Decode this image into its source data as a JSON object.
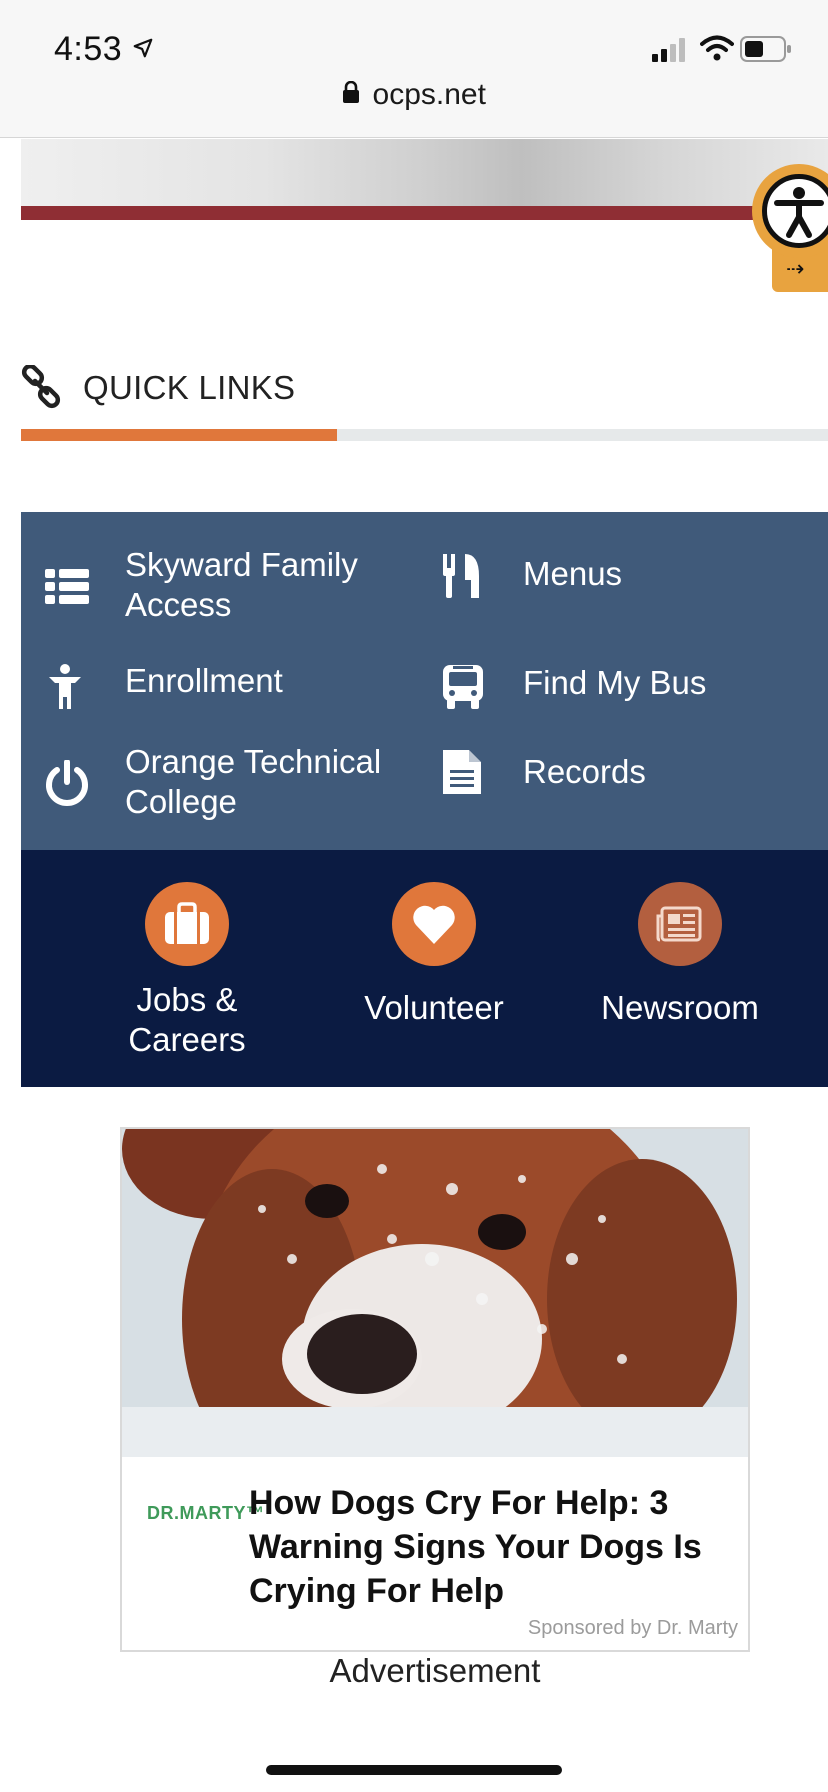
{
  "status_bar": {
    "time": "4:53"
  },
  "browser": {
    "url": "ocps.net"
  },
  "quick_links": {
    "title": "QUICK LINKS",
    "items": [
      {
        "label_line1": "Skyward Family",
        "label_line2": "Access",
        "icon": "list-icon"
      },
      {
        "label_line1": "Menus",
        "label_line2": "",
        "icon": "utensils-icon"
      },
      {
        "label_line1": "Enrollment",
        "label_line2": "",
        "icon": "child-icon"
      },
      {
        "label_line1": "Find My Bus",
        "label_line2": "",
        "icon": "bus-icon"
      },
      {
        "label_line1": "Orange Technical",
        "label_line2": "College",
        "icon": "power-icon"
      },
      {
        "label_line1": "Records",
        "label_line2": "",
        "icon": "document-icon"
      }
    ]
  },
  "features": [
    {
      "label_line1": "Jobs &",
      "label_line2": "Careers",
      "icon": "briefcase-icon"
    },
    {
      "label_line1": "Volunteer",
      "label_line2": "",
      "icon": "heart-icon"
    },
    {
      "label_line1": "Newsroom",
      "label_line2": "",
      "icon": "newspaper-icon"
    }
  ],
  "ad": {
    "brand": "DR.MARTY™",
    "headline": "How Dogs Cry For Help: 3 Warning Signs Your Dogs Is Crying For Help",
    "sponsor": "Sponsored by Dr. Marty",
    "label": "Advertisement"
  },
  "colors": {
    "accent_orange": "#e0773b",
    "grid_blue": "#405a7a",
    "band_navy": "#0b1b42",
    "hero_stripe": "#8f2e34"
  }
}
